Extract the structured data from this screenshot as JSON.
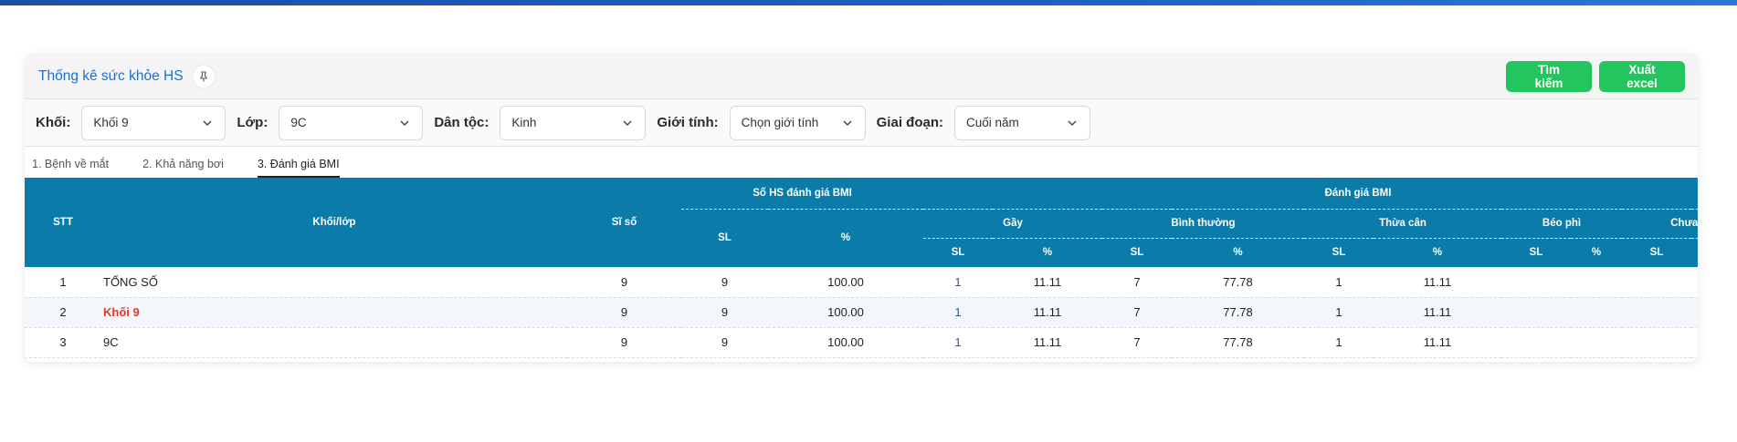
{
  "header": {
    "title": "Thống kê sức khỏe HS",
    "search_label": "Tìm kiếm",
    "export_label": "Xuất excel"
  },
  "filters": [
    {
      "label": "Khối:",
      "value": "Khối 9"
    },
    {
      "label": "Lớp:",
      "value": "9C"
    },
    {
      "label": "Dân tộc:",
      "value": "Kinh"
    },
    {
      "label": "Giới tính:",
      "value": "Chọn giới tính"
    },
    {
      "label": "Giai đoạn:",
      "value": "Cuối năm"
    }
  ],
  "tabs": [
    "1. Bệnh về mắt",
    "2. Khả năng bơi",
    "3. Đánh giá BMI"
  ],
  "active_tab": 2,
  "table": {
    "h_stt": "STT",
    "h_khoi_lop": "Khối/lớp",
    "h_si_so": "Sĩ số",
    "h_so_hs": "Số HS đánh giá BMI",
    "h_danh_gia": "Đánh giá BMI",
    "h_sl": "SL",
    "h_pct": "%",
    "h_gay": "Gầy",
    "h_binh_thuong": "Bình thường",
    "h_thua_can": "Thừa cân",
    "h_beo_phi": "Béo phì",
    "h_chua": "Chưa đánh giá",
    "rows": [
      {
        "stt": "1",
        "name": "TỔNG SỐ",
        "si_so": "9",
        "sl": "9",
        "pct": "100.00",
        "gay_sl": "1",
        "gay_pct": "11.11",
        "bt_sl": "7",
        "bt_pct": "77.78",
        "tc_sl": "1",
        "tc_pct": "11.11",
        "bp_sl": "",
        "bp_pct": "",
        "cd_sl": "",
        "cd_pct": ""
      },
      {
        "stt": "2",
        "name": "Khối 9",
        "si_so": "9",
        "sl": "9",
        "pct": "100.00",
        "gay_sl": "1",
        "gay_pct": "11.11",
        "bt_sl": "7",
        "bt_pct": "77.78",
        "tc_sl": "1",
        "tc_pct": "11.11",
        "bp_sl": "",
        "bp_pct": "",
        "cd_sl": "",
        "cd_pct": ""
      },
      {
        "stt": "3",
        "name": "9C",
        "si_so": "9",
        "sl": "9",
        "pct": "100.00",
        "gay_sl": "1",
        "gay_pct": "11.11",
        "bt_sl": "7",
        "bt_pct": "77.78",
        "tc_sl": "1",
        "tc_pct": "11.11",
        "bp_sl": "",
        "bp_pct": "",
        "cd_sl": "",
        "cd_pct": ""
      }
    ]
  },
  "colors": {
    "accent": "#0b7ca9",
    "button": "#22c55e",
    "title": "#1d6fd1",
    "highlight": "#e23b2e"
  }
}
